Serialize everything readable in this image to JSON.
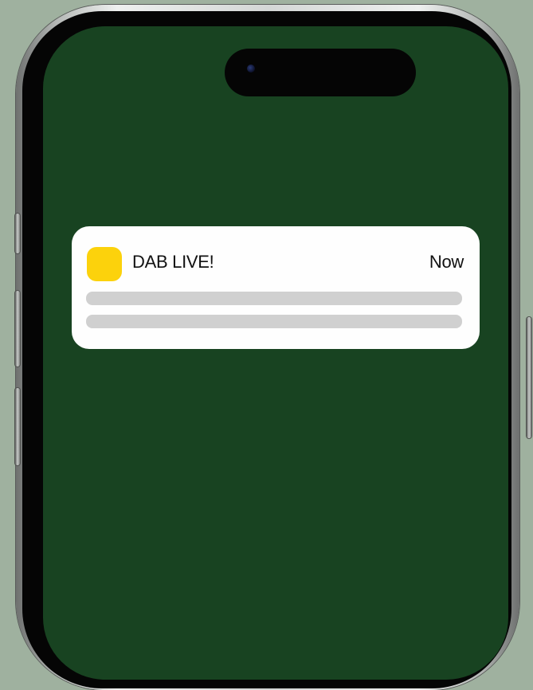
{
  "notification": {
    "app_name": "DAB LIVE!",
    "time": "Now",
    "icon": "app-icon",
    "icon_color": "#FCD20C"
  },
  "screen": {
    "background_color": "#184321"
  }
}
